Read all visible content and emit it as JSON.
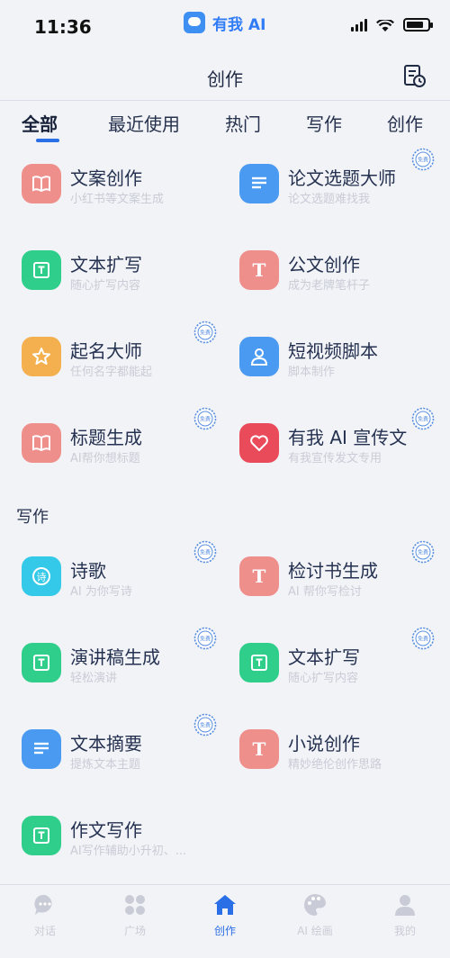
{
  "status": {
    "time": "11:36",
    "app_name": "有我 AI"
  },
  "header": {
    "title": "创作"
  },
  "tabs": [
    "全部",
    "最近使用",
    "热门",
    "写作",
    "创作"
  ],
  "items_top": [
    {
      "name": "文案创作",
      "sub": "小红书等文案生成",
      "icon": "book-icon",
      "color": "#ee8f8c",
      "badge": false
    },
    {
      "name": "论文选题大师",
      "sub": "论文选题难找我",
      "icon": "lines-icon",
      "color": "#4a9af1",
      "badge": true
    },
    {
      "name": "文本扩写",
      "sub": "随心扩写内容",
      "icon": "text-box-icon",
      "color": "#2fcf8b",
      "badge": false
    },
    {
      "name": "公文创作",
      "sub": "成为老牌笔杆子",
      "icon": "t-letter-icon",
      "color": "#ee8f8c",
      "badge": false
    },
    {
      "name": "起名大师",
      "sub": "任何名字都能起",
      "icon": "star-icon",
      "color": "#f4b04e",
      "badge": true
    },
    {
      "name": "短视频脚本",
      "sub": "脚本制作",
      "icon": "person-icon",
      "color": "#4a9af1",
      "badge": false
    },
    {
      "name": "标题生成",
      "sub": "AI帮你想标题",
      "icon": "book-icon",
      "color": "#ee8f8c",
      "badge": true
    },
    {
      "name": "有我 AI 宣传文",
      "sub": "有我宣传发文专用",
      "icon": "heart-icon",
      "color": "#ea4b5b",
      "badge": true
    }
  ],
  "section_writing": {
    "title": "写作",
    "items": [
      {
        "name": "诗歌",
        "sub": "AI 为你写诗",
        "icon": "poem-icon",
        "color": "#34c9e8",
        "badge": true
      },
      {
        "name": "检讨书生成",
        "sub": "AI 帮你写检讨",
        "icon": "t-letter-icon",
        "color": "#ee8f8c",
        "badge": true
      },
      {
        "name": "演讲稿生成",
        "sub": "轻松演讲",
        "icon": "text-box-icon",
        "color": "#2fcf8b",
        "badge": true
      },
      {
        "name": "文本扩写",
        "sub": "随心扩写内容",
        "icon": "text-box-icon",
        "color": "#2fcf8b",
        "badge": true
      },
      {
        "name": "文本摘要",
        "sub": "提炼文本主题",
        "icon": "lines-icon",
        "color": "#4a9af1",
        "badge": true
      },
      {
        "name": "小说创作",
        "sub": "精妙绝伦创作思路",
        "icon": "t-letter-icon",
        "color": "#ee8f8c",
        "badge": false
      },
      {
        "name": "作文写作",
        "sub": "AI写作辅助小升初、...",
        "icon": "text-box-icon",
        "color": "#2fcf8b",
        "badge": false
      }
    ]
  },
  "tabbar": [
    {
      "label": "对话",
      "icon": "chat-icon",
      "active": false
    },
    {
      "label": "广场",
      "icon": "grid-icon",
      "active": false
    },
    {
      "label": "创作",
      "icon": "home-icon",
      "active": true
    },
    {
      "label": "AI 绘画",
      "icon": "palette-icon",
      "active": false
    },
    {
      "label": "我的",
      "icon": "user-icon",
      "active": false
    }
  ],
  "colors": {
    "accent": "#2b6fe6",
    "background": "#f2f3f7",
    "subtitle": "#c9ccd6"
  }
}
